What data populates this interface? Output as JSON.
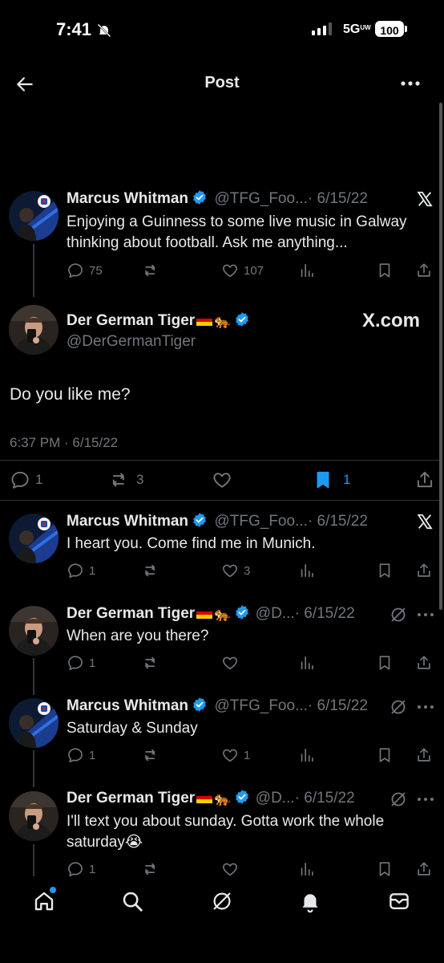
{
  "status_bar": {
    "time": "7:41",
    "network": "5G",
    "network_sub": "UW",
    "battery": "100"
  },
  "header": {
    "title": "Post"
  },
  "parent_post": {
    "author": "Marcus Whitman",
    "handle": "@TFG_Foo...",
    "date": "· 6/15/22",
    "text": "Enjoying a Guinness to some live music in Galway thinking about football. Ask me anything...",
    "replies": "75",
    "likes": "107"
  },
  "main_post": {
    "author": "Der German Tiger",
    "handle": "@DerGermanTiger",
    "watermark": "X.com",
    "text": "Do you like me?",
    "timestamp": "6:37 PM · 6/15/22",
    "replies": "1",
    "reposts": "3",
    "bookmarks": "1"
  },
  "replies": [
    {
      "author": "Marcus Whitman",
      "handle": "@TFG_Foo...",
      "date": "· 6/15/22",
      "text": "I heart you. Come find me in Munich.",
      "reply_count": "1",
      "like_count": "3"
    },
    {
      "author": "Der German Tiger",
      "handle": "@D...",
      "date": "· 6/15/22",
      "text": "When are you there?",
      "reply_count": "1",
      "like_count": ""
    },
    {
      "author": "Marcus Whitman",
      "handle": "@TFG_Foo...",
      "date": "· 6/15/22",
      "text": "Saturday & Sunday",
      "reply_count": "1",
      "like_count": "1"
    },
    {
      "author": "Der German Tiger",
      "handle": "@D...",
      "date": "· 6/15/22",
      "text": "I'll text you about sunday. Gotta work the whole saturday😭",
      "reply_count": "1",
      "like_count": ""
    }
  ],
  "colors": {
    "background": "#000000",
    "text": "#e7e9ea",
    "muted": "#71767b",
    "accent": "#1d9bf0",
    "divider": "#2f3336"
  },
  "icons": {
    "verified": "verified-badge-icon",
    "flag": "germany-flag-icon",
    "tiger": "tiger-emoji-icon",
    "tabs": [
      "home-icon",
      "search-icon",
      "grok-icon",
      "bell-icon",
      "mail-icon"
    ]
  }
}
